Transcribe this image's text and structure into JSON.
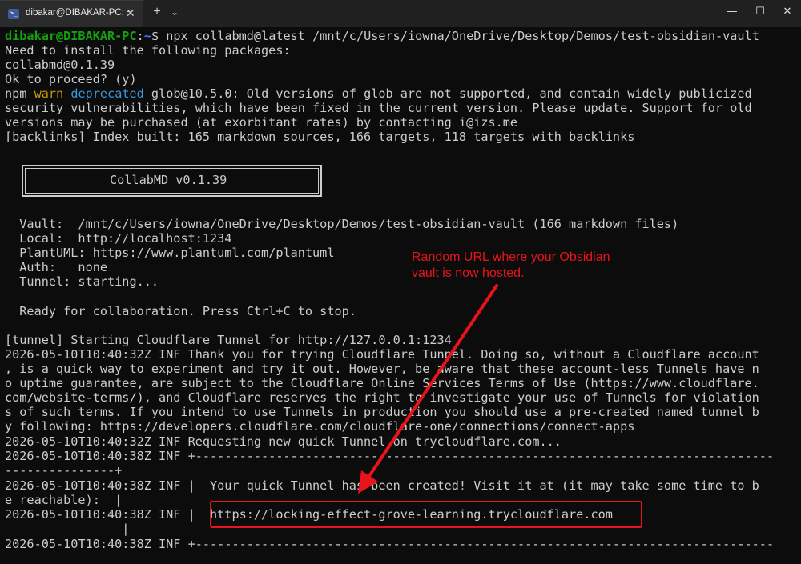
{
  "window": {
    "tab_title": "dibakar@DIBAKAR-PC: ~",
    "tab_icon": "terminal-icon",
    "tab_close": "✕",
    "new_tab": "+",
    "dropdown": "⌄",
    "minimize": "—",
    "maximize": "☐",
    "close": "✕"
  },
  "prompt": {
    "user": "dibakar@DIBAKAR-PC",
    "sep": ":",
    "path": "~",
    "symbol": "$",
    "command": " npx collabmd@latest /mnt/c/Users/iowna/OneDrive/Desktop/Demos/test-obsidian-vault"
  },
  "output": {
    "l1": "Need to install the following packages:",
    "l2": "collabmd@0.1.39",
    "l3": "Ok to proceed? (y)",
    "npm": "npm",
    "warn": "warn",
    "deprecated": "deprecated",
    "l4_rest": " glob@10.5.0: Old versions of glob are not supported, and contain widely publicized",
    "l5": "security vulnerabilities, which have been fixed in the current version. Please update. Support for old",
    "l6": "versions may be purchased (at exorbitant rates) by contacting i@izs.me",
    "l7": "[backlinks] Index built: 165 markdown sources, 166 targets, 118 targets with backlinks",
    "banner": "CollabMD v0.1.39",
    "vault": "  Vault:  /mnt/c/Users/iowna/OneDrive/Desktop/Demos/test-obsidian-vault (166 markdown files)",
    "local": "  Local:  http://localhost:1234",
    "plantuml": "  PlantUML: https://www.plantuml.com/plantuml",
    "auth": "  Auth:   none",
    "tunnel": "  Tunnel: starting...",
    "ready": "  Ready for collaboration. Press Ctrl+C to stop.",
    "t1": "[tunnel] Starting Cloudflare Tunnel for http://127.0.0.1:1234",
    "t2": "2026-05-10T10:40:32Z INF Thank you for trying Cloudflare Tunnel. Doing so, without a Cloudflare account",
    "t3": ", is a quick way to experiment and try it out. However, be aware that these account-less Tunnels have n",
    "t4": "o uptime guarantee, are subject to the Cloudflare Online Services Terms of Use (https://www.cloudflare.",
    "t5": "com/website-terms/), and Cloudflare reserves the right to investigate your use of Tunnels for violation",
    "t6": "s of such terms. If you intend to use Tunnels in production you should use a pre-created named tunnel b",
    "t7": "y following: https://developers.cloudflare.com/cloudflare-one/connections/connect-apps",
    "t8": "2026-05-10T10:40:32Z INF Requesting new quick Tunnel on trycloudflare.com...",
    "t9": "2026-05-10T10:40:38Z INF +-------------------------------------------------------------------------------",
    "t10": "---------------+",
    "t11": "2026-05-10T10:40:38Z INF |  Your quick Tunnel has been created! Visit it at (it may take some time to b",
    "t12": "e reachable):  |",
    "t13": "2026-05-10T10:40:38Z INF |  https://locking-effect-grove-learning.trycloudflare.com",
    "t14": "                |",
    "t15": "2026-05-10T10:40:38Z INF +-------------------------------------------------------------------------------"
  },
  "annotation": {
    "line1": "Random URL where your Obsidian",
    "line2": "vault is now hosted.",
    "color": "#e8141b"
  }
}
